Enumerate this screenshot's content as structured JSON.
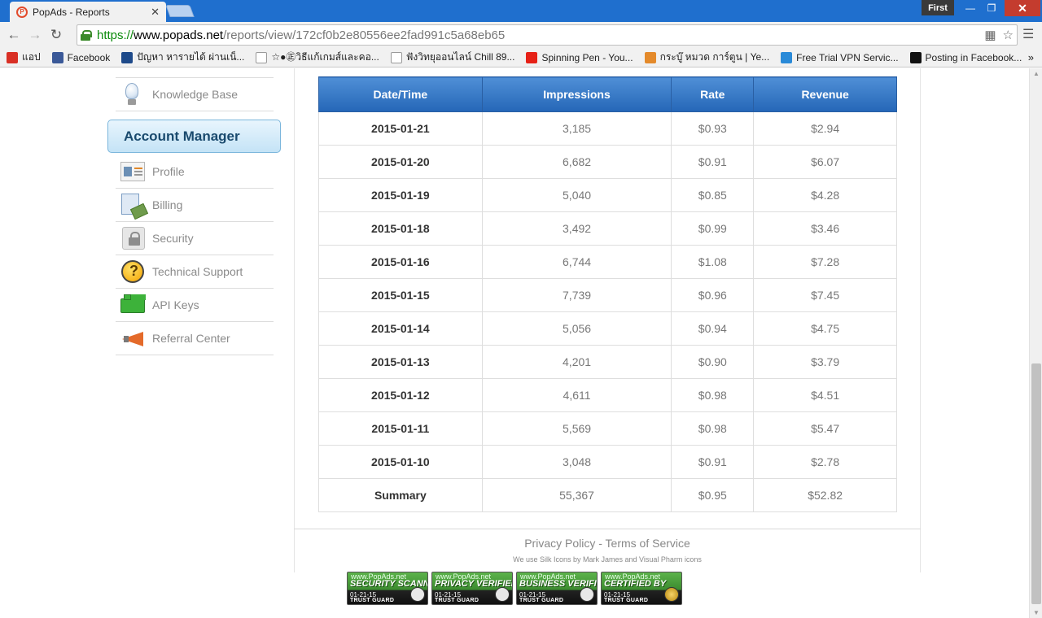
{
  "browser": {
    "tab_title": "PopAds - Reports",
    "tab_close": "✕",
    "profile_name": "First",
    "url": {
      "scheme": "https://",
      "host": "www.popads.net",
      "path": "/reports/view/172cf0b2e80556ee2fad991c5a68eb65"
    },
    "bookmarks": [
      {
        "label": "แอป",
        "icon": "apps-grid-icon",
        "color": "#d93025"
      },
      {
        "label": "Facebook",
        "icon": "facebook-icon",
        "color": "#3b5998"
      },
      {
        "label": "ปัญหา หารายได้ ผ่านเน็...",
        "icon": "site-icon",
        "color": "#1e4a8a"
      },
      {
        "label": "☆●㊣วิธีแก้เกมส์และคอ...",
        "icon": "page-icon",
        "color": "#ffffff"
      },
      {
        "label": "ฟังวิทยุออนไลน์ Chill 89...",
        "icon": "page-icon",
        "color": "#ffffff"
      },
      {
        "label": "Spinning Pen - You...",
        "icon": "youtube-icon",
        "color": "#e62117"
      },
      {
        "label": "กระบู๊ หมวด การ์ตูน | Ye...",
        "icon": "site-icon",
        "color": "#e48a2b"
      },
      {
        "label": "Free Trial VPN Servic...",
        "icon": "vpn-icon",
        "color": "#2a8ad8"
      },
      {
        "label": "Posting in Facebook...",
        "icon": "site-icon",
        "color": "#111111"
      }
    ],
    "bookmarks_more": "»"
  },
  "sidebar": {
    "top_item": {
      "label": "Knowledge Base",
      "icon": "lightbulb-icon"
    },
    "section_title": "Account Manager",
    "items": [
      {
        "label": "Profile",
        "icon": "id-card-icon"
      },
      {
        "label": "Billing",
        "icon": "billing-icon"
      },
      {
        "label": "Security",
        "icon": "lock-icon"
      },
      {
        "label": "Technical Support",
        "icon": "support-icon"
      },
      {
        "label": "API Keys",
        "icon": "lego-brick-icon"
      },
      {
        "label": "Referral Center",
        "icon": "megaphone-icon"
      }
    ]
  },
  "report": {
    "columns": [
      "Date/Time",
      "Impressions",
      "Rate",
      "Revenue"
    ],
    "rows": [
      {
        "date": "2015-01-21",
        "impressions": "3,185",
        "rate": "$0.93",
        "revenue": "$2.94"
      },
      {
        "date": "2015-01-20",
        "impressions": "6,682",
        "rate": "$0.91",
        "revenue": "$6.07"
      },
      {
        "date": "2015-01-19",
        "impressions": "5,040",
        "rate": "$0.85",
        "revenue": "$4.28"
      },
      {
        "date": "2015-01-18",
        "impressions": "3,492",
        "rate": "$0.99",
        "revenue": "$3.46"
      },
      {
        "date": "2015-01-16",
        "impressions": "6,744",
        "rate": "$1.08",
        "revenue": "$7.28"
      },
      {
        "date": "2015-01-15",
        "impressions": "7,739",
        "rate": "$0.96",
        "revenue": "$7.45"
      },
      {
        "date": "2015-01-14",
        "impressions": "5,056",
        "rate": "$0.94",
        "revenue": "$4.75"
      },
      {
        "date": "2015-01-13",
        "impressions": "4,201",
        "rate": "$0.90",
        "revenue": "$3.79"
      },
      {
        "date": "2015-01-12",
        "impressions": "4,611",
        "rate": "$0.98",
        "revenue": "$4.51"
      },
      {
        "date": "2015-01-11",
        "impressions": "5,569",
        "rate": "$0.98",
        "revenue": "$5.47"
      },
      {
        "date": "2015-01-10",
        "impressions": "3,048",
        "rate": "$0.91",
        "revenue": "$2.78"
      }
    ],
    "summary": {
      "date": "Summary",
      "impressions": "55,367",
      "rate": "$0.95",
      "revenue": "$52.82"
    }
  },
  "footer": {
    "privacy": "Privacy Policy",
    "separator": " - ",
    "terms": "Terms of Service",
    "credit": "We use Silk Icons by Mark James and Visual Pharm icons"
  },
  "badges": [
    {
      "site": "www.PopAds.net",
      "title": "SECURITY SCANNED",
      "date": "01-21-15",
      "guard": "TRUST GUARD"
    },
    {
      "site": "www.PopAds.net",
      "title": "PRIVACY VERIFIED",
      "date": "01-21-15",
      "guard": "TRUST GUARD"
    },
    {
      "site": "www.PopAds.net",
      "title": "BUSINESS VERIFIED",
      "date": "01-21-15",
      "guard": "TRUST GUARD"
    },
    {
      "site": "www.PopAds.net",
      "title": "CERTIFIED BY",
      "date": "01-21-15",
      "guard": "TRUST GUARD"
    }
  ]
}
